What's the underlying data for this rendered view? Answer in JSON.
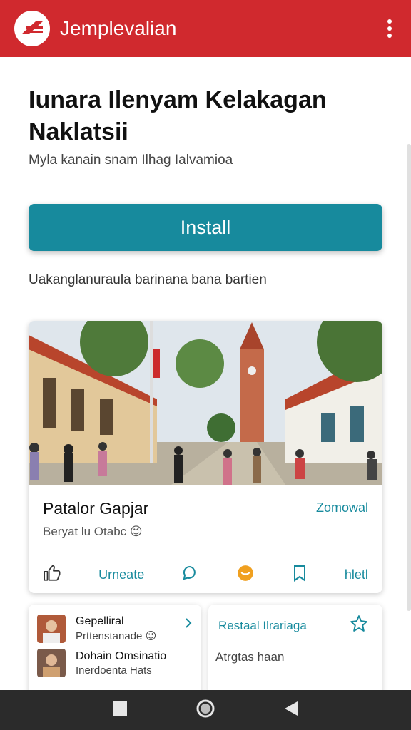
{
  "appbar": {
    "title": "Jemplevalian",
    "color": "#d0292e",
    "logo_icon": "brand-logo-icon",
    "menu_icon": "more-vert-icon"
  },
  "hero": {
    "headline": "Iunara Ilenyam Kelakagan Naklatsii",
    "subtitle": "Myla kanain snam Ilhag Ialvamioa",
    "install_label": "Install",
    "install_color": "#178a9d",
    "note": "Uakanglanuraula barinana bana bartien"
  },
  "feature_card": {
    "image_alt": "street-scene-photo",
    "title": "Patalor Gapjar",
    "link": "Zomowal",
    "subtitle": "Beryat lu Otabc",
    "subtitle_emoji": "😉",
    "actions": {
      "like_icon": "thumbs-up-icon",
      "share_label": "Urneate",
      "comment_icon": "chat-bubble-icon",
      "react_icon": "emoji-heart-icon",
      "bookmark_icon": "bookmark-icon",
      "more_label": "hletl"
    }
  },
  "list_card": {
    "items": [
      {
        "title": "Gepelliral",
        "subtitle": "Prttenstanade",
        "subtitle_emoji": "😉"
      },
      {
        "title": "Dohain Omsinatio",
        "subtitle": "Inerdoenta Hats"
      }
    ]
  },
  "rated_card": {
    "title": "Restaal Ilrariaga",
    "subtitle": "Atrgtas haan",
    "star_icon": "star-outline-icon"
  },
  "navbar": {
    "recents_icon": "recents-square-icon",
    "home_icon": "home-circle-icon",
    "back_icon": "back-triangle-icon"
  }
}
